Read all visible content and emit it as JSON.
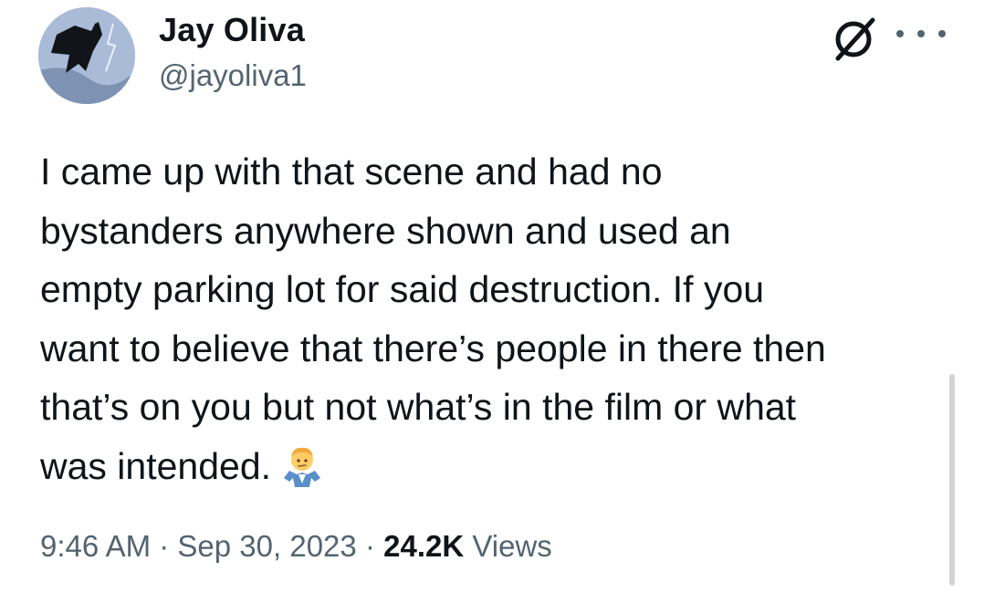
{
  "author": {
    "display_name": "Jay Oliva",
    "handle": "@jayoliva1",
    "avatar_icon": "batman-leaping-avatar"
  },
  "header_actions": {
    "grok_icon": "slashed-circle-icon",
    "more_icon": "more-dots-icon"
  },
  "tweet": {
    "lines": [
      "I came up with that scene and had no",
      "bystanders anywhere shown and used an",
      "empty parking lot for said destruction. If you",
      "want to believe that there’s people in there then",
      "that’s on you but not what’s in the film or what",
      "was intended."
    ],
    "emoji": "man-shrugging-emoji"
  },
  "meta": {
    "time": "9:46 AM",
    "separator": "·",
    "date": "Sep 30, 2023",
    "views_count": "24.2K",
    "views_label": "Views"
  },
  "colors": {
    "text_primary": "#0f1419",
    "text_secondary": "#536471",
    "background": "#ffffff"
  }
}
